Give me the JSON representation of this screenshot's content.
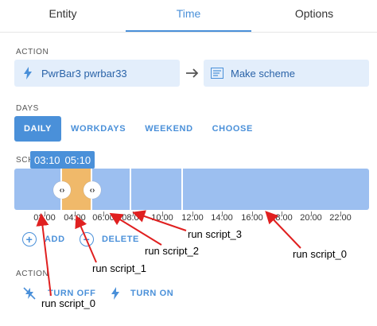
{
  "tabs": [
    {
      "label": "Entity",
      "active": false
    },
    {
      "label": "Time",
      "active": true
    },
    {
      "label": "Options",
      "active": false
    }
  ],
  "action": {
    "section_label": "ACTION",
    "entity_label": "PwrBar3 pwrbar33",
    "entity_icon": "lightning-icon",
    "target_label": "Make scheme",
    "target_icon": "script-list-icon"
  },
  "days": {
    "section_label": "DAYS",
    "options": [
      "DAILY",
      "WORKDAYS",
      "WEEKEND",
      "CHOOSE"
    ],
    "selected": "DAILY"
  },
  "schedule": {
    "section_label": "SCH",
    "start_time": "03:10",
    "end_time": "05:10",
    "tick_labels": [
      "00:00",
      "02:00",
      "04:00",
      "06:00",
      "08:00",
      "10:00",
      "12:00",
      "14:00",
      "16:00",
      "18:00",
      "20:00",
      "22:00"
    ],
    "handle_glyph": "‹›"
  },
  "buttons": {
    "add_label": "ADD",
    "delete_label": "DELETE"
  },
  "action2": {
    "section_label": "ACTION",
    "turn_off_label": "TURN OFF",
    "turn_on_label": "TURN ON"
  },
  "annotations": {
    "script0_top": "run script_0",
    "script0_bottom": "run script_0",
    "script1": "run script_1",
    "script2": "run script_2",
    "script3": "run script_3"
  },
  "colors": {
    "accent": "#4a90d9",
    "timeline": "#9cbff0",
    "slot": "#f0b96a",
    "annotation_arrow": "#e02020"
  }
}
